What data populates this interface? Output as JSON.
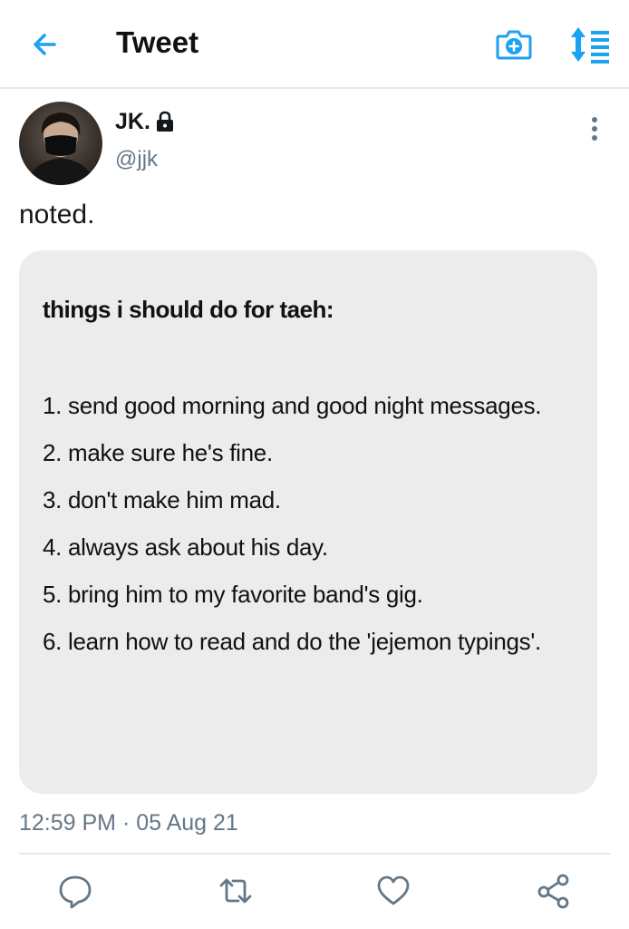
{
  "header": {
    "title": "Tweet",
    "back_icon": "arrow-left-icon",
    "camera_icon": "camera-plus-icon",
    "sort_icon": "sort-list-icon"
  },
  "author": {
    "display_name": "JK.",
    "handle": "@jjk",
    "protected_icon": "lock-icon"
  },
  "tweet": {
    "text": "noted.",
    "timestamp": "12:59 PM · 05 Aug 21"
  },
  "attached_image": {
    "title": "things i should do for taeh:",
    "items": [
      "1. send good morning and good night messages.",
      "2. make sure he's fine.",
      "3. don't make him mad.",
      "4. always ask about his day.",
      "5. bring him to my favorite band's gig.",
      "6. learn how to read and do the 'jejemon typings'."
    ]
  },
  "actions": {
    "reply_icon": "comment-icon",
    "retweet_icon": "retweet-icon",
    "like_icon": "heart-icon",
    "share_icon": "share-icon"
  },
  "colors": {
    "accent": "#1da1f2",
    "secondary_text": "#657786",
    "card_bg": "#ececec",
    "divider": "#e1e8ed"
  }
}
